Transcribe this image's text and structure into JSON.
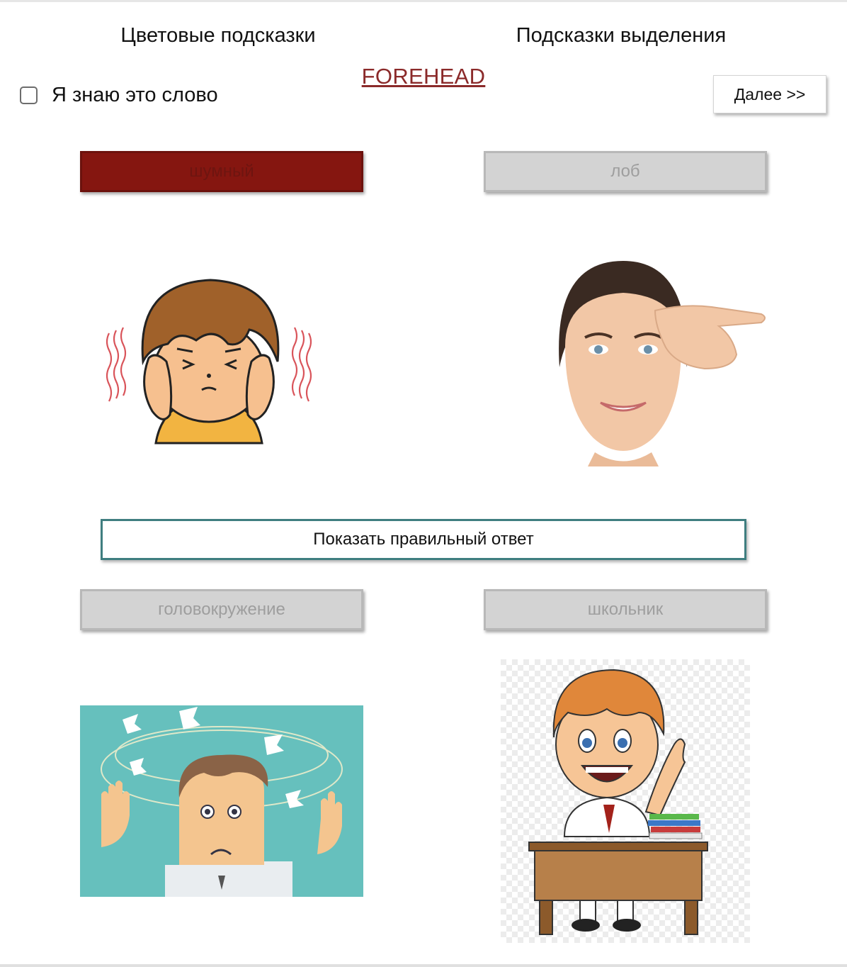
{
  "header": {
    "color_hints_label": "Цветовые подсказки",
    "highlight_hints_label": "Подсказки выделения",
    "target_word": "FOREHEAD",
    "know_word_label": "Я знаю это слово",
    "know_word_checked": false,
    "next_label": "Далее >>"
  },
  "options": [
    {
      "label": "шумный",
      "picture": "boy-covering-ears",
      "state": "selected-wrong"
    },
    {
      "label": "лоб",
      "picture": "woman-pointing-forehead",
      "state": "default"
    },
    {
      "label": "головокружение",
      "picture": "dizzy-man",
      "state": "default"
    },
    {
      "label": "школьник",
      "picture": "schoolboy-at-desk",
      "state": "default"
    }
  ],
  "show_answer_label": "Показать правильный ответ",
  "colors": {
    "selected_wrong": "#851610",
    "target_word": "#8b2a2a",
    "show_answer_border": "#3f7e80",
    "option_default": "#d3d3d3"
  }
}
